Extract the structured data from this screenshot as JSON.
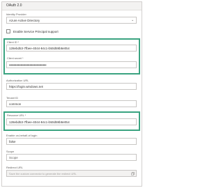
{
  "section": {
    "title": "OAuth 2.0"
  },
  "identity_provider": {
    "label": "Identity Provider",
    "value": "Azure Active Directory"
  },
  "service_principal": {
    "label": "Enable Service Principal support"
  },
  "client_id": {
    "label": "Client ID *",
    "value": "128ebd53-7fbee-4044-94c1-b50d59b8e054"
  },
  "client_secret": {
    "label": "Client secret *",
    "value": "••••••••••••••••••••••••••••••••••••••••••"
  },
  "authorization_url": {
    "label": "Authorization URL",
    "value": "https://login.windows.net"
  },
  "tenant_id": {
    "label": "Tenant ID",
    "value": "common"
  },
  "resource_url": {
    "label": "Resource URL *",
    "value": "128ebd53-7fbee-4044-94c1-b50d59b8e054"
  },
  "on_behalf_of": {
    "label": "Enable on-behalf-of login",
    "value": "false"
  },
  "scope": {
    "label": "Scope",
    "placeholder": "Scope"
  },
  "redirect_url": {
    "label": "Redirect URL",
    "placeholder": "Save the custom connector to generate the redirect URL"
  }
}
